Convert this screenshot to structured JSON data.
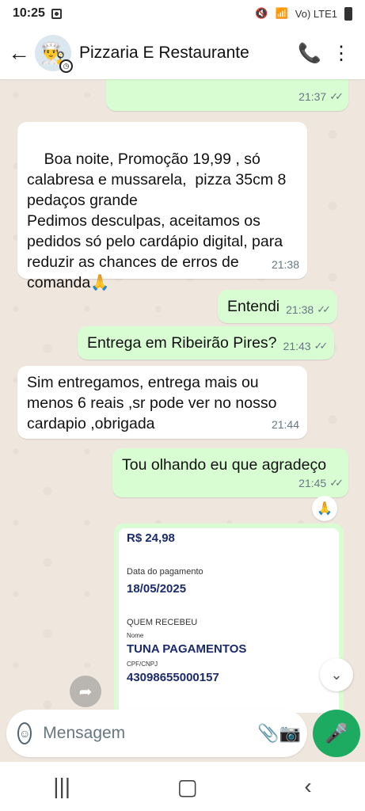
{
  "status": {
    "time": "10:25",
    "network": "Vo) LTE1"
  },
  "header": {
    "contact_name": "Pizzaria E Restaurante"
  },
  "messages": [
    {
      "text": "",
      "time": "21:37"
    },
    {
      "text": "Boa noite, Promoção 19,99 , só calabresa e mussarela,  pizza 35cm 8 pedaços grande\nPedimos desculpas, aceitamos os pedidos só pelo cardápio digital, para reduzir as chances de erros de comanda🙏",
      "time": "21:38"
    },
    {
      "text": "Entendi",
      "time": "21:38"
    },
    {
      "text": "Entrega em Ribeirão Pires?",
      "time": "21:43"
    },
    {
      "text": "Sim entregamos, entrega mais ou menos 6 reais ,sr pode ver no nosso cardapio ,obrigada",
      "time": "21:44"
    },
    {
      "text": "Tou olhando eu que agradeço",
      "time": "21:45"
    }
  ],
  "reaction": "🙏",
  "receipt": {
    "amount": "R$ 24,98",
    "date_label": "Data do pagamento",
    "date_value": "18/05/2025",
    "section_title": "QUEM RECEBEU",
    "name_label": "Nome",
    "name_value": "TUNA PAGAMENTOS",
    "doc_label": "CPF/CNPJ",
    "doc_value": "43098655000157"
  },
  "composer": {
    "placeholder": "Mensagem"
  },
  "colors": {
    "outgoing": "#d9fdd3",
    "incoming": "#ffffff",
    "accent": "#1daa61"
  },
  "icons": [
    "back-arrow",
    "add-call",
    "more-vert",
    "emoji",
    "attach",
    "camera",
    "mic",
    "forward",
    "scroll-down"
  ]
}
